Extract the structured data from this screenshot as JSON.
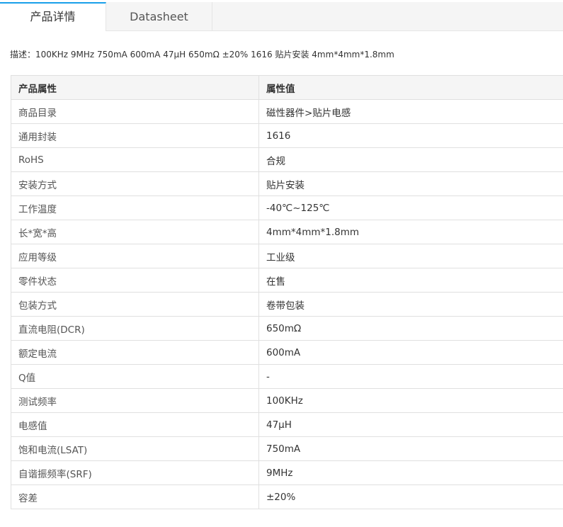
{
  "tabs": [
    {
      "label": "产品详情",
      "active": true
    },
    {
      "label": "Datasheet",
      "active": false
    }
  ],
  "description": "描述：100KHz 9MHz 750mA 600mA 47μH 650mΩ ±20% 1616 贴片安装 4mm*4mm*1.8mm",
  "table": {
    "headers": [
      "产品属性",
      "属性值"
    ],
    "rows": [
      [
        "商品目录",
        "磁性器件>贴片电感"
      ],
      [
        "通用封装",
        "1616"
      ],
      [
        "RoHS",
        "合规"
      ],
      [
        "安装方式",
        "贴片安装"
      ],
      [
        "工作温度",
        "-40℃~125℃"
      ],
      [
        "长*宽*高",
        "4mm*4mm*1.8mm"
      ],
      [
        "应用等级",
        "工业级"
      ],
      [
        "零件状态",
        "在售"
      ],
      [
        "包装方式",
        "卷带包装"
      ],
      [
        "直流电阻(DCR)",
        "650mΩ"
      ],
      [
        "额定电流",
        "600mA"
      ],
      [
        "Q值",
        "-"
      ],
      [
        "测试频率",
        "100KHz"
      ],
      [
        "电感值",
        "47μH"
      ],
      [
        "饱和电流(LSAT)",
        "750mA"
      ],
      [
        "自谐振频率(SRF)",
        "9MHz"
      ],
      [
        "容差",
        "±20%"
      ]
    ]
  },
  "colors": {
    "accent": "#199fe9",
    "header_bg": "#f5f5f5",
    "border": "#e0e0e0"
  }
}
